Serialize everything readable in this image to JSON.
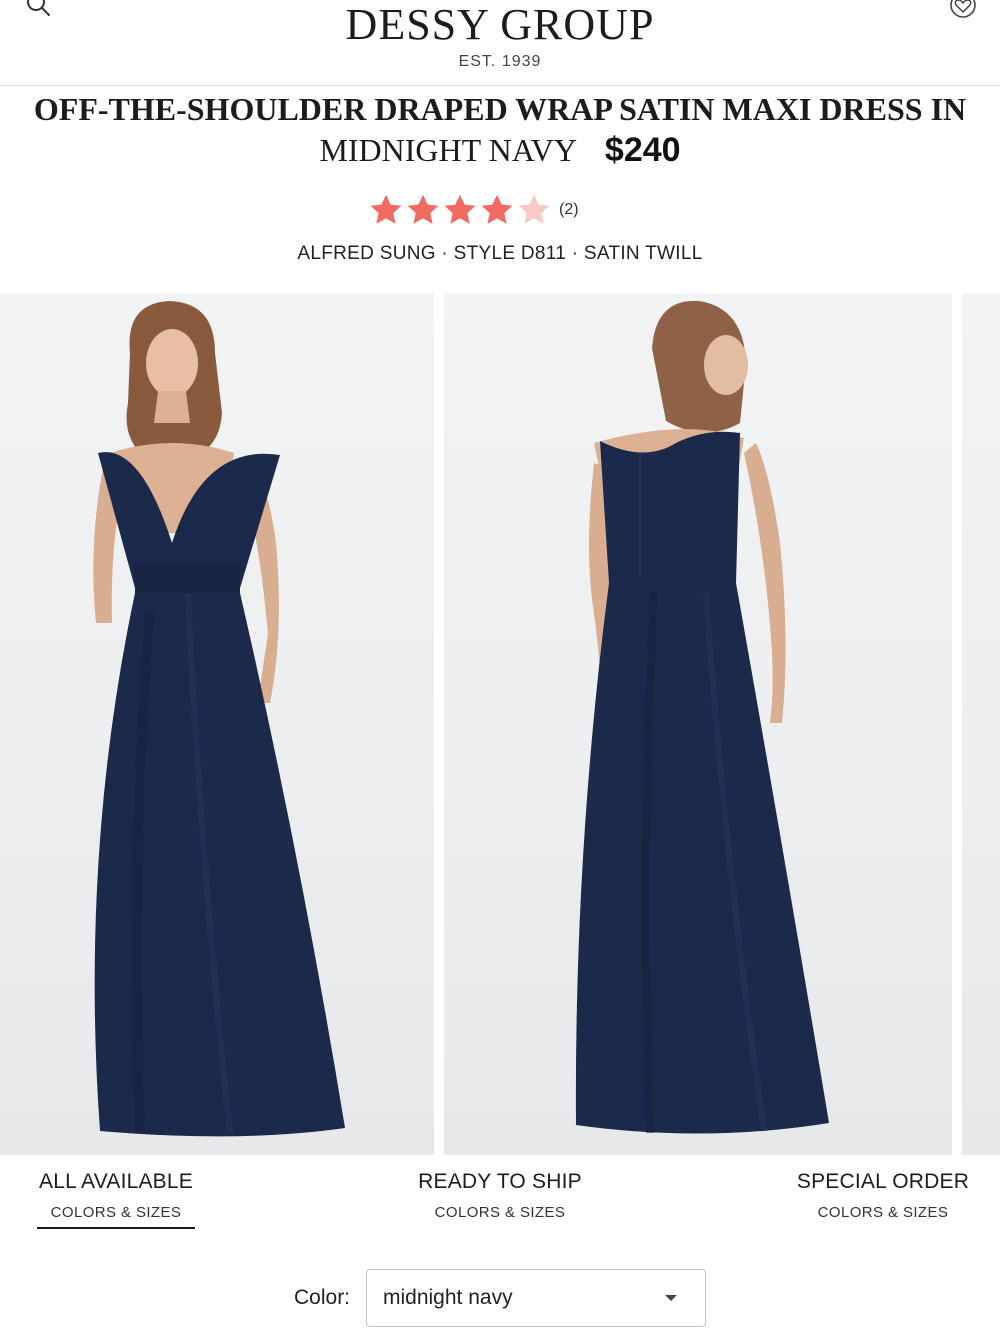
{
  "header": {
    "brand": "DESSY GROUP",
    "brand_sub": "EST. 1939",
    "search_icon": "search-icon",
    "wishlist_icon": "heart-icon"
  },
  "product": {
    "title_line1": "OFF-THE-SHOULDER DRAPED WRAP SATIN MAXI DRESS IN",
    "title_line2": "MIDNIGHT NAVY",
    "price": "$240",
    "rating": 4,
    "rating_max": 5,
    "review_count": "(2)",
    "meta": "ALFRED SUNG · STYLE D811 · SATIN TWILL"
  },
  "gallery": {
    "images": [
      {
        "view": "front"
      },
      {
        "view": "back"
      },
      {
        "view": "partial"
      }
    ]
  },
  "tabs": [
    {
      "label": "ALL AVAILABLE",
      "sub": "COLORS & SIZES",
      "selected": true
    },
    {
      "label": "READY TO SHIP",
      "sub": "COLORS & SIZES",
      "selected": false
    },
    {
      "label": "SPECIAL ORDER",
      "sub": "COLORS & SIZES",
      "selected": false
    }
  ],
  "color_select": {
    "label": "Color:",
    "value": "midnight navy"
  },
  "colors": {
    "star_filled": "#f26b63",
    "star_empty": "#f9c9c6",
    "dress": "#1b2a4a",
    "text": "#1c1c1c"
  }
}
